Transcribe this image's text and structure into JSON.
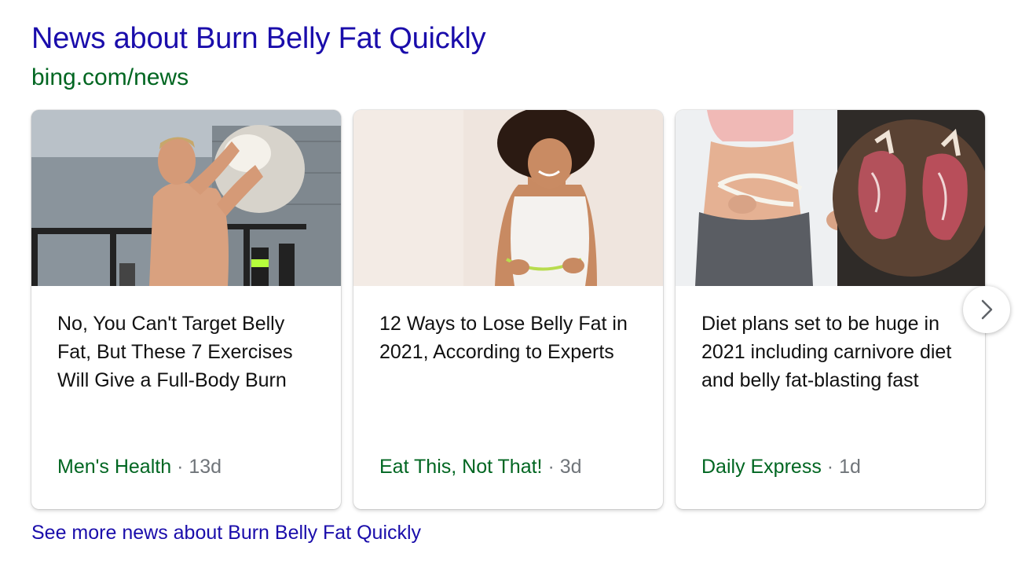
{
  "header": {
    "title": "News about Burn Belly Fat Quickly",
    "source": "bing.com/news"
  },
  "cards": [
    {
      "headline": "No, You Can't Target Belly Fat, But These 7 Exercises Will Give a Full-Body Burn",
      "publisher": "Men's Health",
      "separator": "·",
      "age": "13d"
    },
    {
      "headline": "12 Ways to Lose Belly Fat in 2021, According to Experts",
      "publisher": "Eat This, Not That!",
      "separator": "·",
      "age": "3d"
    },
    {
      "headline": "Diet plans set to be huge in 2021 including carnivore diet and belly fat-blasting fast",
      "publisher": "Daily Express",
      "separator": "·",
      "age": "1d"
    }
  ],
  "navigation": {
    "next_icon": "chevron-right-icon"
  },
  "footer": {
    "see_more": "See more news about Burn Belly Fat Quickly"
  },
  "colors": {
    "link_blue": "#1a0dab",
    "source_green": "#006621",
    "muted_gray": "#70757a"
  }
}
